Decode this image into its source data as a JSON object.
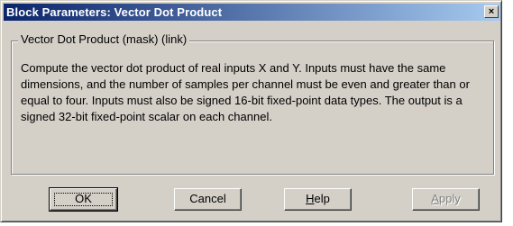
{
  "window": {
    "title": "Block Parameters: Vector Dot Product",
    "close_glyph": "×"
  },
  "group": {
    "label": "Vector Dot Product (mask) (link)",
    "description": "Compute the vector dot product of real inputs X and Y. Inputs must have the same dimensions, and the number of samples per channel must be even and greater than or equal to four. Inputs must also be signed 16-bit fixed-point data types. The output is a signed 32-bit fixed-point scalar on each channel."
  },
  "buttons": {
    "ok": "OK",
    "cancel": "Cancel",
    "help_first": "H",
    "help_rest": "elp",
    "apply_first": "A",
    "apply_rest": "pply"
  },
  "colors": {
    "titlebar_start": "#0a246a",
    "titlebar_end": "#a6caf0",
    "face": "#d4d0c8"
  }
}
